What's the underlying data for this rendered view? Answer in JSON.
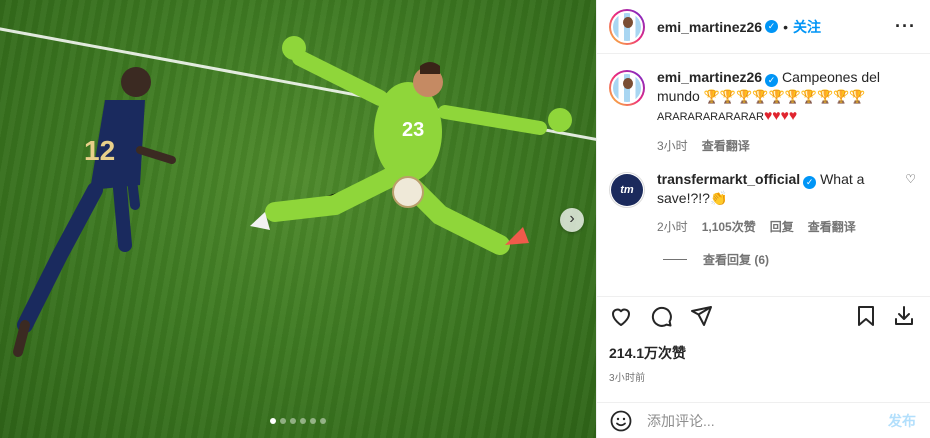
{
  "post": {
    "author": "emi_martinez26",
    "follow_label": "关注",
    "more_label": "···",
    "next_label": "›",
    "carousel_count": 6,
    "carousel_active": 0
  },
  "comments": [
    {
      "username": "emi_martinez26",
      "text": "Campeones del mundo",
      "trophies": "🏆🏆🏆🏆🏆🏆🏆🏆🏆🏆",
      "caps": "ARARARARARARAR",
      "hearts": "♥♥♥♥",
      "time": "3小时",
      "translate": "查看翻译"
    },
    {
      "username": "transfermarkt_official",
      "avatar_text": "tm",
      "text": "What a save!?!?",
      "emoji": "👏",
      "time": "2小时",
      "likes": "1,105次赞",
      "reply": "回复",
      "translate": "查看翻译",
      "view_replies": "查看回复 (6)"
    }
  ],
  "stats": {
    "likes": "214.1万次赞",
    "time": "3小时前"
  },
  "composer": {
    "placeholder": "添加评论...",
    "post_label": "发布"
  },
  "colors": {
    "accent": "#0095f6",
    "verified": "#0095f6",
    "heart": "#e0242e",
    "post_disabled": "#b2dffc"
  }
}
